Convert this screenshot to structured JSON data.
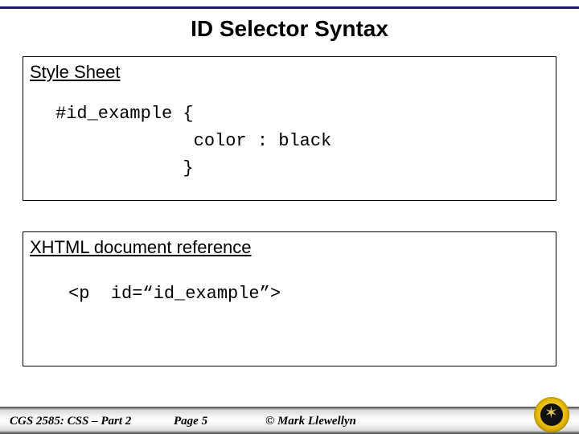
{
  "title": "ID Selector Syntax",
  "box1": {
    "label": "Style Sheet",
    "code": "#id_example {\n             color : black\n            }"
  },
  "box2": {
    "label": "XHTML document reference",
    "code": "<p  id=“id_example”>"
  },
  "footer": {
    "course": "CGS 2585: CSS – Part 2",
    "page": "Page 5",
    "author": "© Mark Llewellyn"
  }
}
